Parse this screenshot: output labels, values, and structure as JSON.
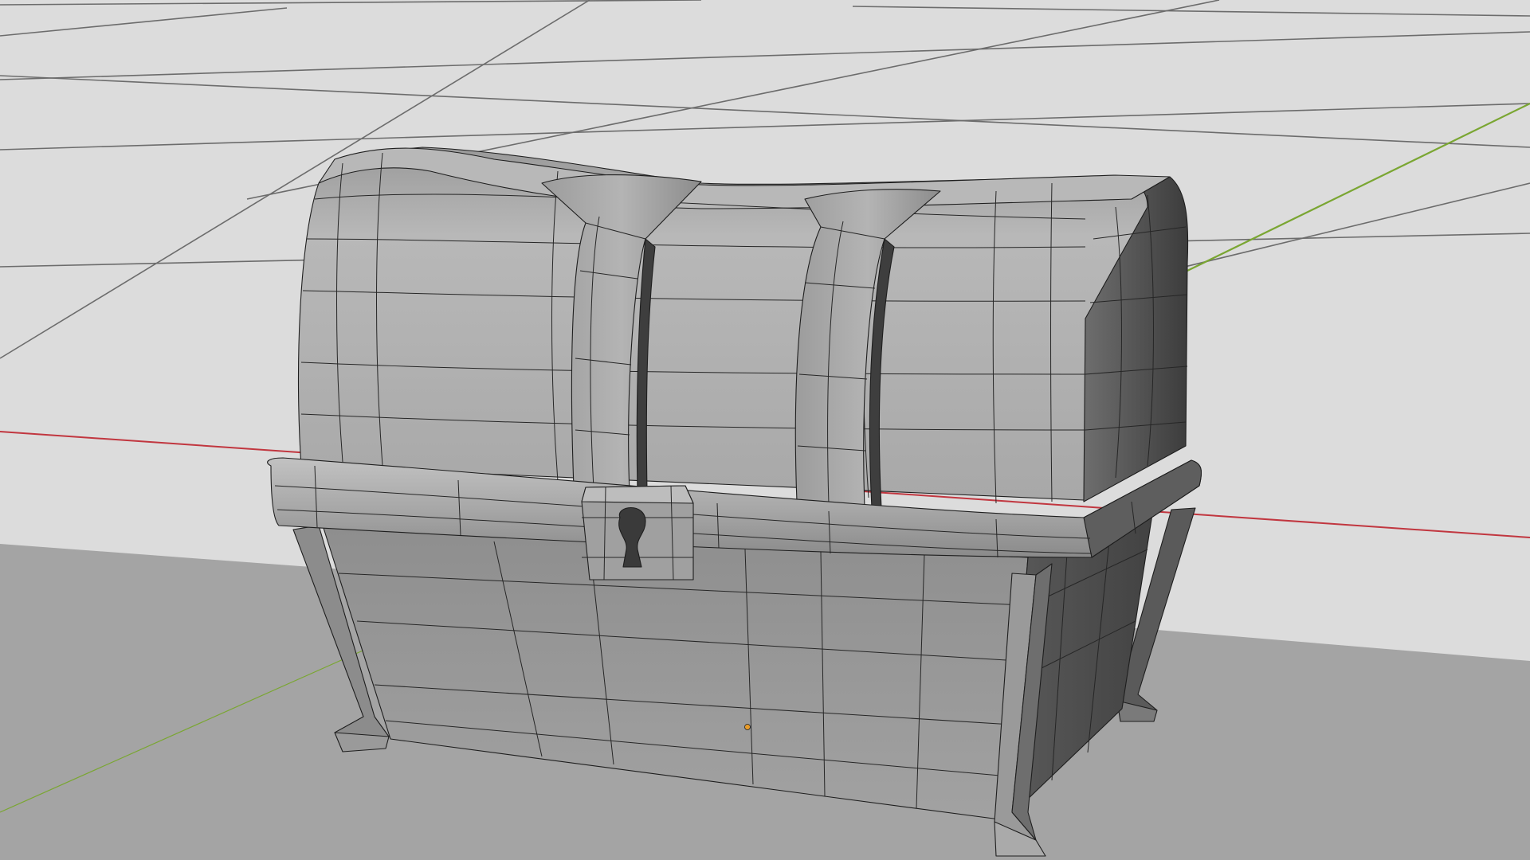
{
  "viewport": {
    "background_color": "#dcdcdc",
    "floor_color": "#a4a4a4",
    "grid_line_color": "#6c6c6c",
    "x_axis_color": "#c1363f",
    "y_axis_color": "#7aa632",
    "wire_color": "#1e1e1e",
    "origin_color": "#e89c2a"
  },
  "object": {
    "type": "treasure-chest",
    "shading": "solid",
    "wireframe_overlay": true,
    "body_color": "#9e9e9e",
    "lid_color": "#a6a6a6",
    "dark_side_color": "#4c4c4c"
  }
}
